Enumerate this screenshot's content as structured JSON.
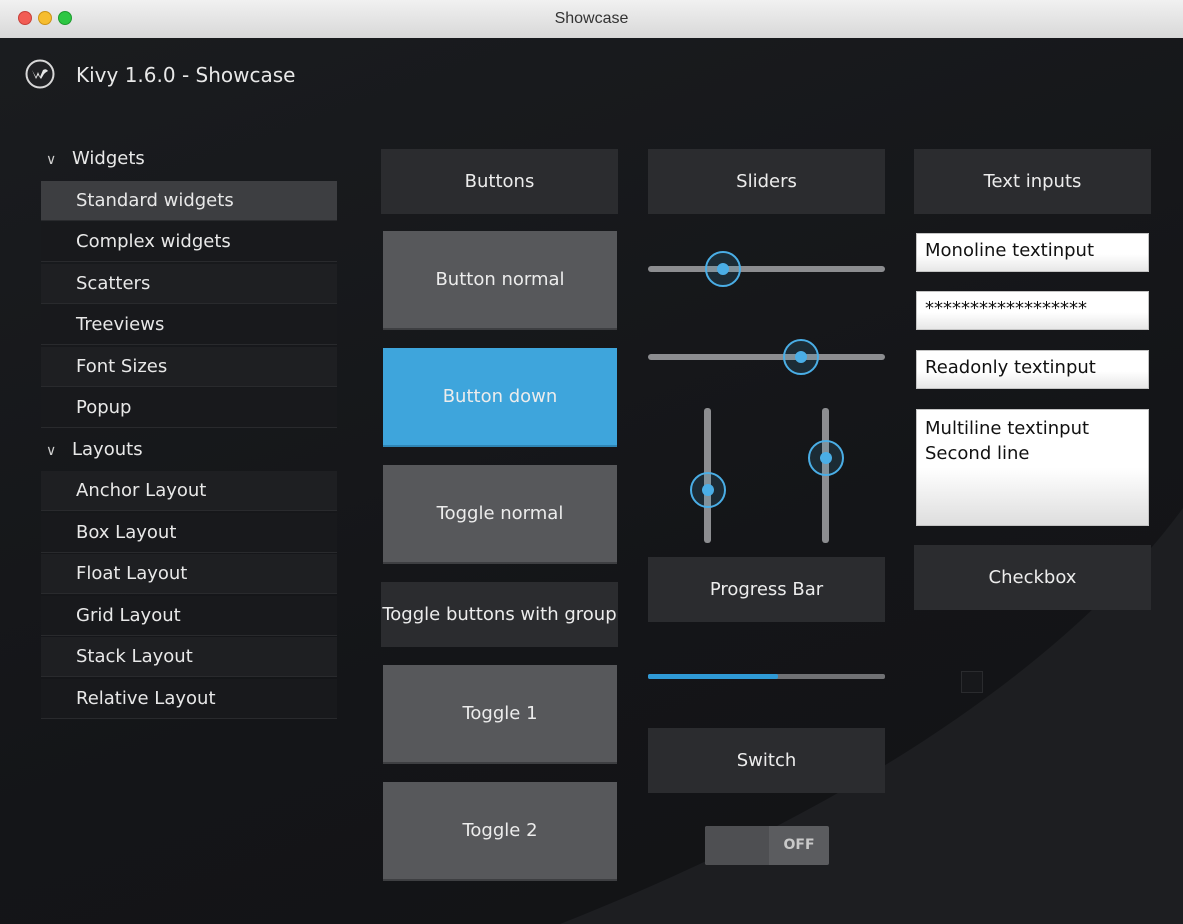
{
  "window": {
    "title": "Showcase"
  },
  "app": {
    "title": "Kivy 1.6.0 - Showcase"
  },
  "sidebar": {
    "widgets_group": "Widgets",
    "widgets": [
      "Standard widgets",
      "Complex widgets",
      "Scatters",
      "Treeviews",
      "Font Sizes",
      "Popup"
    ],
    "layouts_group": "Layouts",
    "layouts": [
      "Anchor Layout",
      "Box Layout",
      "Float Layout",
      "Grid Layout",
      "Stack Layout",
      "Relative Layout"
    ],
    "selected": "Standard widgets"
  },
  "buttons": {
    "header": "Buttons",
    "normal": "Button normal",
    "down": "Button down",
    "toggle_normal": "Toggle normal",
    "toggle_group_header": "Toggle buttons with group",
    "toggle1": "Toggle 1",
    "toggle2": "Toggle 2"
  },
  "sliders": {
    "header": "Sliders",
    "values": [
      0.25,
      0.7,
      0.3,
      0.75
    ]
  },
  "progress": {
    "header": "Progress Bar",
    "value": 0.55
  },
  "switch": {
    "header": "Switch",
    "state_label": "OFF"
  },
  "text_inputs": {
    "header": "Text inputs",
    "monoline": "Monoline textinput",
    "password": "******************",
    "readonly": "Readonly textinput",
    "multiline": "Multiline textinput\nSecond line"
  },
  "checkbox": {
    "header": "Checkbox",
    "checked": false
  },
  "colors": {
    "accent": "#3ea5dc",
    "button": "#57585b",
    "header": "#2b2c2f"
  }
}
